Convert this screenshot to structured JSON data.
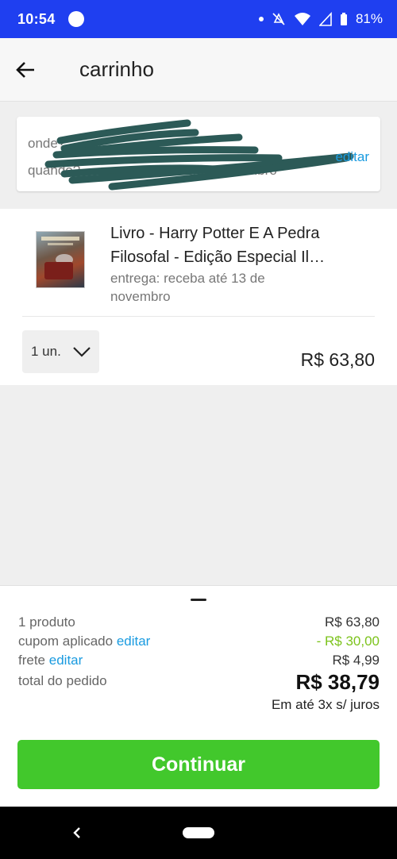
{
  "status_bar": {
    "time": "10:54",
    "battery": "81%",
    "icons": [
      "notification-dot-icon",
      "mute-icon",
      "wifi-icon",
      "signal-icon",
      "battery-icon"
    ]
  },
  "app_bar": {
    "title": "carrinho",
    "back_icon": "arrow-left-icon"
  },
  "delivery": {
    "where_label": "onde?",
    "when_label": "quando?",
    "when_value": "13 de novembro",
    "edit_label": "editar"
  },
  "product": {
    "title_line1": "Livro - Harry Potter E A Pedra",
    "title_line2": "Filosofal - Edição Especial Il…",
    "delivery_line1": "entrega: receba até 13 de",
    "delivery_line2": "novembro",
    "quantity": "1 un.",
    "price": "R$ 63,80"
  },
  "summary": {
    "items_label": "1 produto",
    "items_value": "R$ 63,80",
    "coupon_label": "cupom aplicado",
    "coupon_edit": "editar",
    "coupon_value": "- R$ 30,00",
    "shipping_label": "frete",
    "shipping_edit": "editar",
    "shipping_value": "R$ 4,99",
    "total_label": "total do pedido",
    "total_value": "R$ 38,79",
    "installments": "Em até 3x s/ juros"
  },
  "continue_button": "Continuar",
  "colors": {
    "status_bar": "#1f3ff0",
    "link": "#1a9be0",
    "discount": "#7cc31c",
    "primary_button": "#42c82c",
    "redaction": "#2c5a57"
  }
}
